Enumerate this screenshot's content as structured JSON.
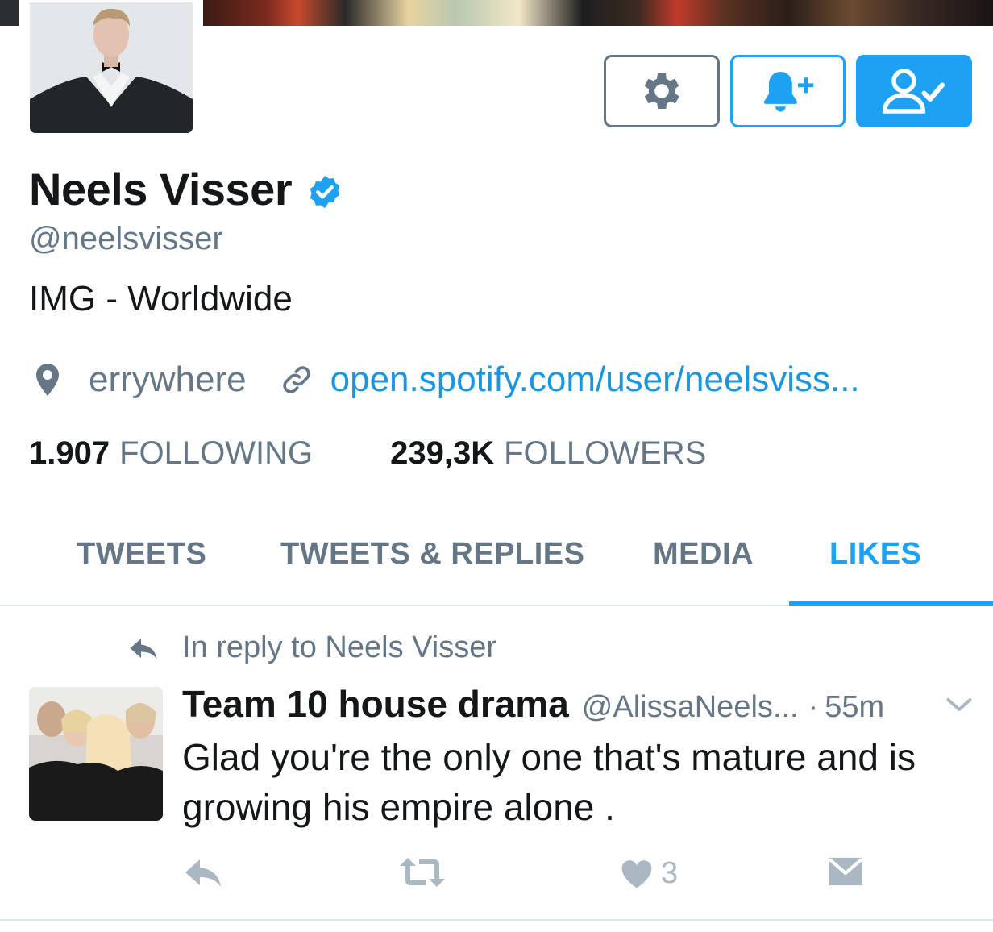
{
  "colors": {
    "accent": "#1da1f2",
    "link": "#1b95e0",
    "text_primary": "#14171a",
    "text_secondary": "#657786",
    "icon_muted": "#aab8c2"
  },
  "profile": {
    "name": "Neels Visser",
    "verified": true,
    "handle": "@neelsvisser",
    "bio": "IMG - Worldwide",
    "location": "errywhere",
    "url": "open.spotify.com/user/neelsviss...",
    "following_count": "1.907",
    "following_label": "FOLLOWING",
    "followers_count": "239,3K",
    "followers_label": "FOLLOWERS"
  },
  "actions": {
    "settings_icon": "gear-icon",
    "notify_icon": "bell-plus-icon",
    "follow_icon": "user-check-icon"
  },
  "tabs": [
    {
      "label": "TWEETS",
      "active": false
    },
    {
      "label": "TWEETS & REPLIES",
      "active": false
    },
    {
      "label": "MEDIA",
      "active": false
    },
    {
      "label": "LIKES",
      "active": true
    }
  ],
  "tweet": {
    "reply_context": "In reply to Neels Visser",
    "author": "Team 10 house drama",
    "handle": "@AlissaNeels...",
    "separator": "·",
    "time": "55m",
    "text": "Glad you're the only one that's mature and is growing his empire alone .",
    "like_count": "3"
  }
}
